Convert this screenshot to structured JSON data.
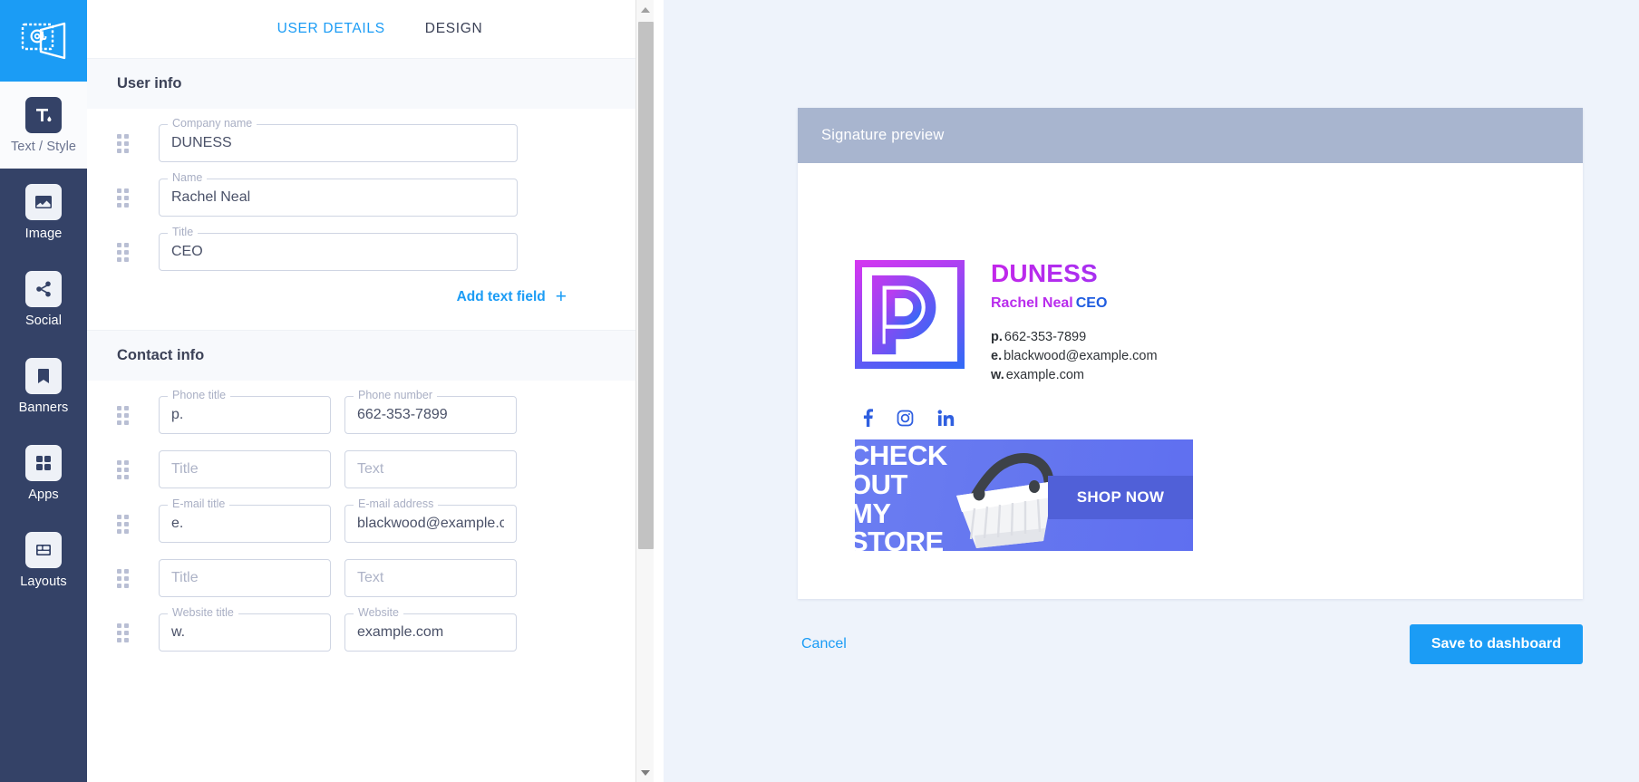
{
  "sidebar": {
    "logo_icon": "envelope-at-logo",
    "items": [
      {
        "label": "Text / Style",
        "icon": "text-style-icon",
        "active": true
      },
      {
        "label": "Image",
        "icon": "image-icon",
        "active": false
      },
      {
        "label": "Social",
        "icon": "share-icon",
        "active": false
      },
      {
        "label": "Banners",
        "icon": "bookmark-icon",
        "active": false
      },
      {
        "label": "Apps",
        "icon": "grid-icon",
        "active": false
      },
      {
        "label": "Layouts",
        "icon": "layouts-icon",
        "active": false
      }
    ]
  },
  "tabs": [
    {
      "label": "USER DETAILS",
      "active": true
    },
    {
      "label": "DESIGN",
      "active": false
    }
  ],
  "sections": {
    "user_info": {
      "title": "User info",
      "rows": [
        {
          "label": "Company name",
          "value": "DUNESS",
          "placeholder": ""
        },
        {
          "label": "Name",
          "value": "Rachel Neal",
          "placeholder": ""
        },
        {
          "label": "Title",
          "value": "CEO",
          "placeholder": ""
        }
      ],
      "add_field_label": "Add text field",
      "add_field_plus": "+"
    },
    "contact_info": {
      "title": "Contact info",
      "rows": [
        {
          "left": {
            "label": "Phone title",
            "value": "p.",
            "placeholder": ""
          },
          "right": {
            "label": "Phone number",
            "value": "662-353-7899",
            "placeholder": ""
          }
        },
        {
          "left": {
            "label": "",
            "value": "",
            "placeholder": "Title"
          },
          "right": {
            "label": "",
            "value": "",
            "placeholder": "Text"
          }
        },
        {
          "left": {
            "label": "E-mail title",
            "value": "e.",
            "placeholder": ""
          },
          "right": {
            "label": "E-mail address",
            "value": "blackwood@example.c",
            "placeholder": ""
          }
        },
        {
          "left": {
            "label": "",
            "value": "",
            "placeholder": "Title"
          },
          "right": {
            "label": "",
            "value": "",
            "placeholder": "Text"
          }
        },
        {
          "left": {
            "label": "Website title",
            "value": "w.",
            "placeholder": ""
          },
          "right": {
            "label": "Website",
            "value": "example.com",
            "placeholder": ""
          }
        }
      ]
    }
  },
  "preview": {
    "header": "Signature preview",
    "signature": {
      "company": "DUNESS",
      "person_name": "Rachel Neal",
      "person_title": "CEO",
      "contact_lines": [
        {
          "prefix": "p.",
          "text": "662-353-7899"
        },
        {
          "prefix": "e.",
          "text": "blackwood@example.com"
        },
        {
          "prefix": "w.",
          "text": "example.com"
        }
      ],
      "social": [
        {
          "name": "facebook-icon"
        },
        {
          "name": "instagram-icon"
        },
        {
          "name": "linkedin-icon"
        }
      ],
      "banner": {
        "headline": "CHECK\nOUT\nMY\nSTORE",
        "cta": "SHOP NOW"
      }
    }
  },
  "footer": {
    "cancel_label": "Cancel",
    "save_label": "Save to dashboard"
  },
  "colors": {
    "accent": "#1b9cf5",
    "rail": "#344267",
    "preview_header": "#a8b5cf",
    "brand_magenta": "#b92ded",
    "brand_blue": "#1f5ce0",
    "banner_blue": "#6577ef"
  }
}
